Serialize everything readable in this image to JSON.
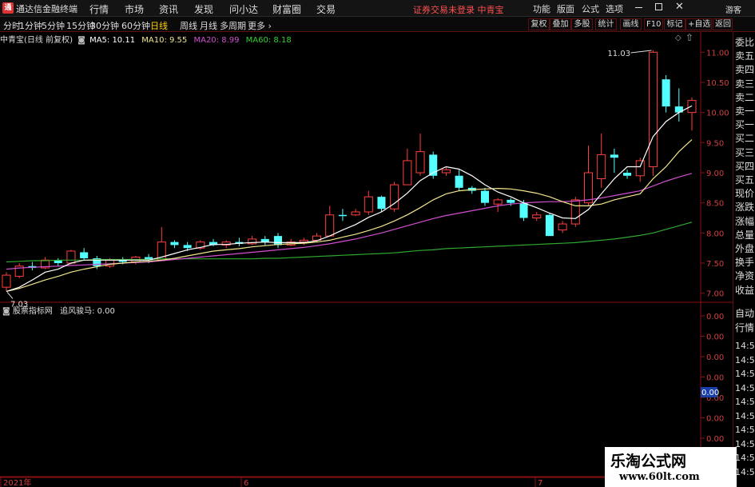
{
  "titlebar": {
    "logo": "通",
    "app_title": "通达信金融终端",
    "menus": [
      "行情",
      "市场",
      "资讯",
      "发现",
      "问小达",
      "财富圈",
      "交易"
    ],
    "status": "证券交易未登录 中青宝",
    "right_menus": [
      "功能",
      "版面",
      "公式",
      "选项"
    ],
    "guest": "游客"
  },
  "periods": {
    "tabs": [
      "分时",
      "1分钟",
      "5分钟",
      "15分钟",
      "30分钟",
      "60分钟",
      "日线",
      "周线",
      "月线",
      "多周期",
      "更多 ›"
    ],
    "active": "日线",
    "right_buttons": [
      "复权",
      "叠加",
      "多股",
      "统计",
      "画线",
      "F10",
      "标记",
      "+自选",
      "返回"
    ]
  },
  "price_header": {
    "stock": "中青宝(日线 前复权)",
    "ma5": "MA5: 10.11",
    "ma10": "MA10: 9.55",
    "ma20": "MA20: 8.99",
    "ma60": "MA60: 8.18"
  },
  "indicator_header": {
    "name": "股票指标网",
    "value": "追风骏马: 0.00"
  },
  "right_panel": {
    "items": [
      "委比",
      "卖五",
      "卖四",
      "卖三",
      "卖二",
      "卖一",
      "买一",
      "买二",
      "买三",
      "买四",
      "买五",
      "现价",
      "涨跌",
      "涨幅",
      "总量",
      "外盘",
      "换手",
      "净资",
      "收益"
    ],
    "items2": [
      "自动",
      "行情"
    ],
    "times": [
      "14:5",
      "14:5",
      "14:5",
      "14:5",
      "14:5",
      "14:5",
      "14:5",
      "14:5",
      "14:5",
      "14:5"
    ]
  },
  "watermark": {
    "line1": "乐淘公式网",
    "line2": "www.60lt.com"
  },
  "colors": {
    "up": "#ff4040",
    "down": "#54ffff",
    "ma5": "#ffffff",
    "ma10": "#f0e68c",
    "ma20": "#d04fd0",
    "ma60": "#2fa82f",
    "axis": "#8a1010",
    "label": "#d04040"
  },
  "chart_data": {
    "type": "candlestick",
    "yticks": [
      7.0,
      7.5,
      8.0,
      8.5,
      9.0,
      9.5,
      10.0,
      10.5,
      11.0
    ],
    "ind_yticks": [
      0.0,
      0.0,
      0.0,
      0.0,
      0.0,
      0.0,
      0.0,
      0.0
    ],
    "current_ind": "0.00",
    "high_label": "11.03",
    "low_label": "7.03",
    "xlabels": [
      "2021年",
      "6",
      "7"
    ],
    "candles": [
      [
        7.1,
        7.3,
        7.03,
        7.35
      ],
      [
        7.28,
        7.45,
        7.25,
        7.5
      ],
      [
        7.45,
        7.42,
        7.38,
        7.52
      ],
      [
        7.42,
        7.55,
        7.4,
        7.6
      ],
      [
        7.55,
        7.5,
        7.45,
        7.58
      ],
      [
        7.5,
        7.7,
        7.48,
        7.72
      ],
      [
        7.68,
        7.58,
        7.55,
        7.75
      ],
      [
        7.58,
        7.45,
        7.4,
        7.62
      ],
      [
        7.45,
        7.55,
        7.42,
        7.58
      ],
      [
        7.55,
        7.52,
        7.48,
        7.6
      ],
      [
        7.52,
        7.6,
        7.48,
        7.62
      ],
      [
        7.6,
        7.55,
        7.5,
        7.65
      ],
      [
        7.55,
        7.85,
        7.55,
        8.1
      ],
      [
        7.85,
        7.8,
        7.75,
        7.88
      ],
      [
        7.8,
        7.75,
        7.7,
        7.85
      ],
      [
        7.75,
        7.85,
        7.72,
        7.88
      ],
      [
        7.85,
        7.8,
        7.78,
        7.9
      ],
      [
        7.8,
        7.85,
        7.75,
        7.88
      ],
      [
        7.85,
        7.82,
        7.78,
        7.92
      ],
      [
        7.82,
        7.9,
        7.8,
        7.95
      ],
      [
        7.9,
        7.85,
        7.8,
        7.95
      ],
      [
        7.95,
        7.8,
        7.75,
        8.0
      ],
      [
        7.8,
        7.85,
        7.78,
        7.9
      ],
      [
        7.85,
        7.88,
        7.8,
        7.92
      ],
      [
        7.88,
        7.95,
        7.85,
        8.0
      ],
      [
        7.95,
        8.3,
        7.95,
        8.45
      ],
      [
        8.3,
        8.28,
        8.2,
        8.4
      ],
      [
        8.3,
        8.35,
        8.28,
        8.4
      ],
      [
        8.35,
        8.6,
        8.3,
        8.7
      ],
      [
        8.6,
        8.4,
        8.35,
        8.62
      ],
      [
        8.4,
        8.8,
        8.35,
        8.85
      ],
      [
        8.8,
        9.2,
        8.8,
        9.4
      ],
      [
        9.0,
        9.35,
        8.95,
        9.65
      ],
      [
        9.3,
        8.95,
        8.9,
        9.35
      ],
      [
        9.0,
        9.05,
        8.95,
        9.1
      ],
      [
        8.95,
        8.75,
        8.7,
        9.05
      ],
      [
        8.75,
        8.7,
        8.65,
        8.78
      ],
      [
        8.7,
        8.5,
        8.45,
        8.75
      ],
      [
        8.48,
        8.55,
        8.35,
        8.58
      ],
      [
        8.55,
        8.5,
        8.45,
        8.58
      ],
      [
        8.5,
        8.25,
        8.2,
        8.55
      ],
      [
        8.25,
        8.3,
        8.2,
        8.35
      ],
      [
        8.3,
        7.95,
        7.95,
        8.32
      ],
      [
        8.05,
        8.15,
        8.0,
        8.2
      ],
      [
        8.15,
        8.55,
        8.1,
        8.6
      ],
      [
        8.5,
        9.0,
        8.45,
        9.45
      ],
      [
        8.9,
        9.3,
        8.75,
        9.65
      ],
      [
        9.3,
        9.25,
        9.0,
        9.4
      ],
      [
        9.0,
        8.95,
        8.9,
        9.05
      ],
      [
        8.95,
        9.2,
        8.85,
        9.25
      ],
      [
        9.1,
        11.0,
        8.95,
        11.03
      ],
      [
        10.55,
        10.1,
        10.0,
        10.62
      ],
      [
        10.1,
        10.0,
        9.85,
        10.4
      ],
      [
        10.0,
        10.2,
        9.7,
        10.25
      ]
    ],
    "ma5": [
      7.03,
      7.1,
      7.22,
      7.35,
      7.4,
      7.5,
      7.55,
      7.55,
      7.55,
      7.55,
      7.55,
      7.55,
      7.6,
      7.66,
      7.72,
      7.76,
      7.81,
      7.81,
      7.83,
      7.84,
      7.85,
      7.84,
      7.84,
      7.84,
      7.87,
      7.95,
      8.05,
      8.14,
      8.26,
      8.35,
      8.49,
      8.66,
      8.87,
      9.0,
      9.1,
      9.06,
      8.95,
      8.8,
      8.68,
      8.6,
      8.5,
      8.42,
      8.33,
      8.25,
      8.24,
      8.39,
      8.65,
      8.9,
      9.1,
      9.1,
      9.6,
      9.85,
      10.0,
      10.11
    ],
    "ma10": [
      7.03,
      7.08,
      7.15,
      7.22,
      7.28,
      7.35,
      7.4,
      7.44,
      7.48,
      7.5,
      7.52,
      7.53,
      7.55,
      7.58,
      7.62,
      7.66,
      7.7,
      7.72,
      7.74,
      7.77,
      7.79,
      7.81,
      7.82,
      7.83,
      7.85,
      7.88,
      7.93,
      7.98,
      8.04,
      8.11,
      8.2,
      8.3,
      8.42,
      8.55,
      8.65,
      8.7,
      8.72,
      8.73,
      8.74,
      8.73,
      8.7,
      8.66,
      8.6,
      8.52,
      8.45,
      8.45,
      8.48,
      8.55,
      8.6,
      8.65,
      8.9,
      9.1,
      9.35,
      9.55
    ],
    "ma20": [
      7.4,
      7.42,
      7.43,
      7.44,
      7.45,
      7.46,
      7.47,
      7.48,
      7.49,
      7.5,
      7.51,
      7.52,
      7.54,
      7.56,
      7.58,
      7.6,
      7.62,
      7.64,
      7.66,
      7.68,
      7.7,
      7.72,
      7.74,
      7.76,
      7.79,
      7.82,
      7.86,
      7.9,
      7.95,
      8.0,
      8.06,
      8.12,
      8.18,
      8.24,
      8.29,
      8.33,
      8.37,
      8.41,
      8.45,
      8.48,
      8.5,
      8.51,
      8.52,
      8.52,
      8.53,
      8.55,
      8.58,
      8.62,
      8.66,
      8.7,
      8.78,
      8.86,
      8.93,
      8.99
    ],
    "ma60": [
      7.52,
      7.53,
      7.54,
      7.54,
      7.55,
      7.55,
      7.55,
      7.56,
      7.56,
      7.56,
      7.56,
      7.56,
      7.57,
      7.57,
      7.57,
      7.57,
      7.57,
      7.57,
      7.57,
      7.57,
      7.58,
      7.58,
      7.59,
      7.6,
      7.61,
      7.62,
      7.63,
      7.64,
      7.65,
      7.66,
      7.67,
      7.69,
      7.71,
      7.72,
      7.74,
      7.75,
      7.76,
      7.77,
      7.78,
      7.79,
      7.8,
      7.81,
      7.82,
      7.83,
      7.84,
      7.86,
      7.88,
      7.9,
      7.93,
      7.96,
      8.0,
      8.06,
      8.12,
      8.18
    ]
  }
}
